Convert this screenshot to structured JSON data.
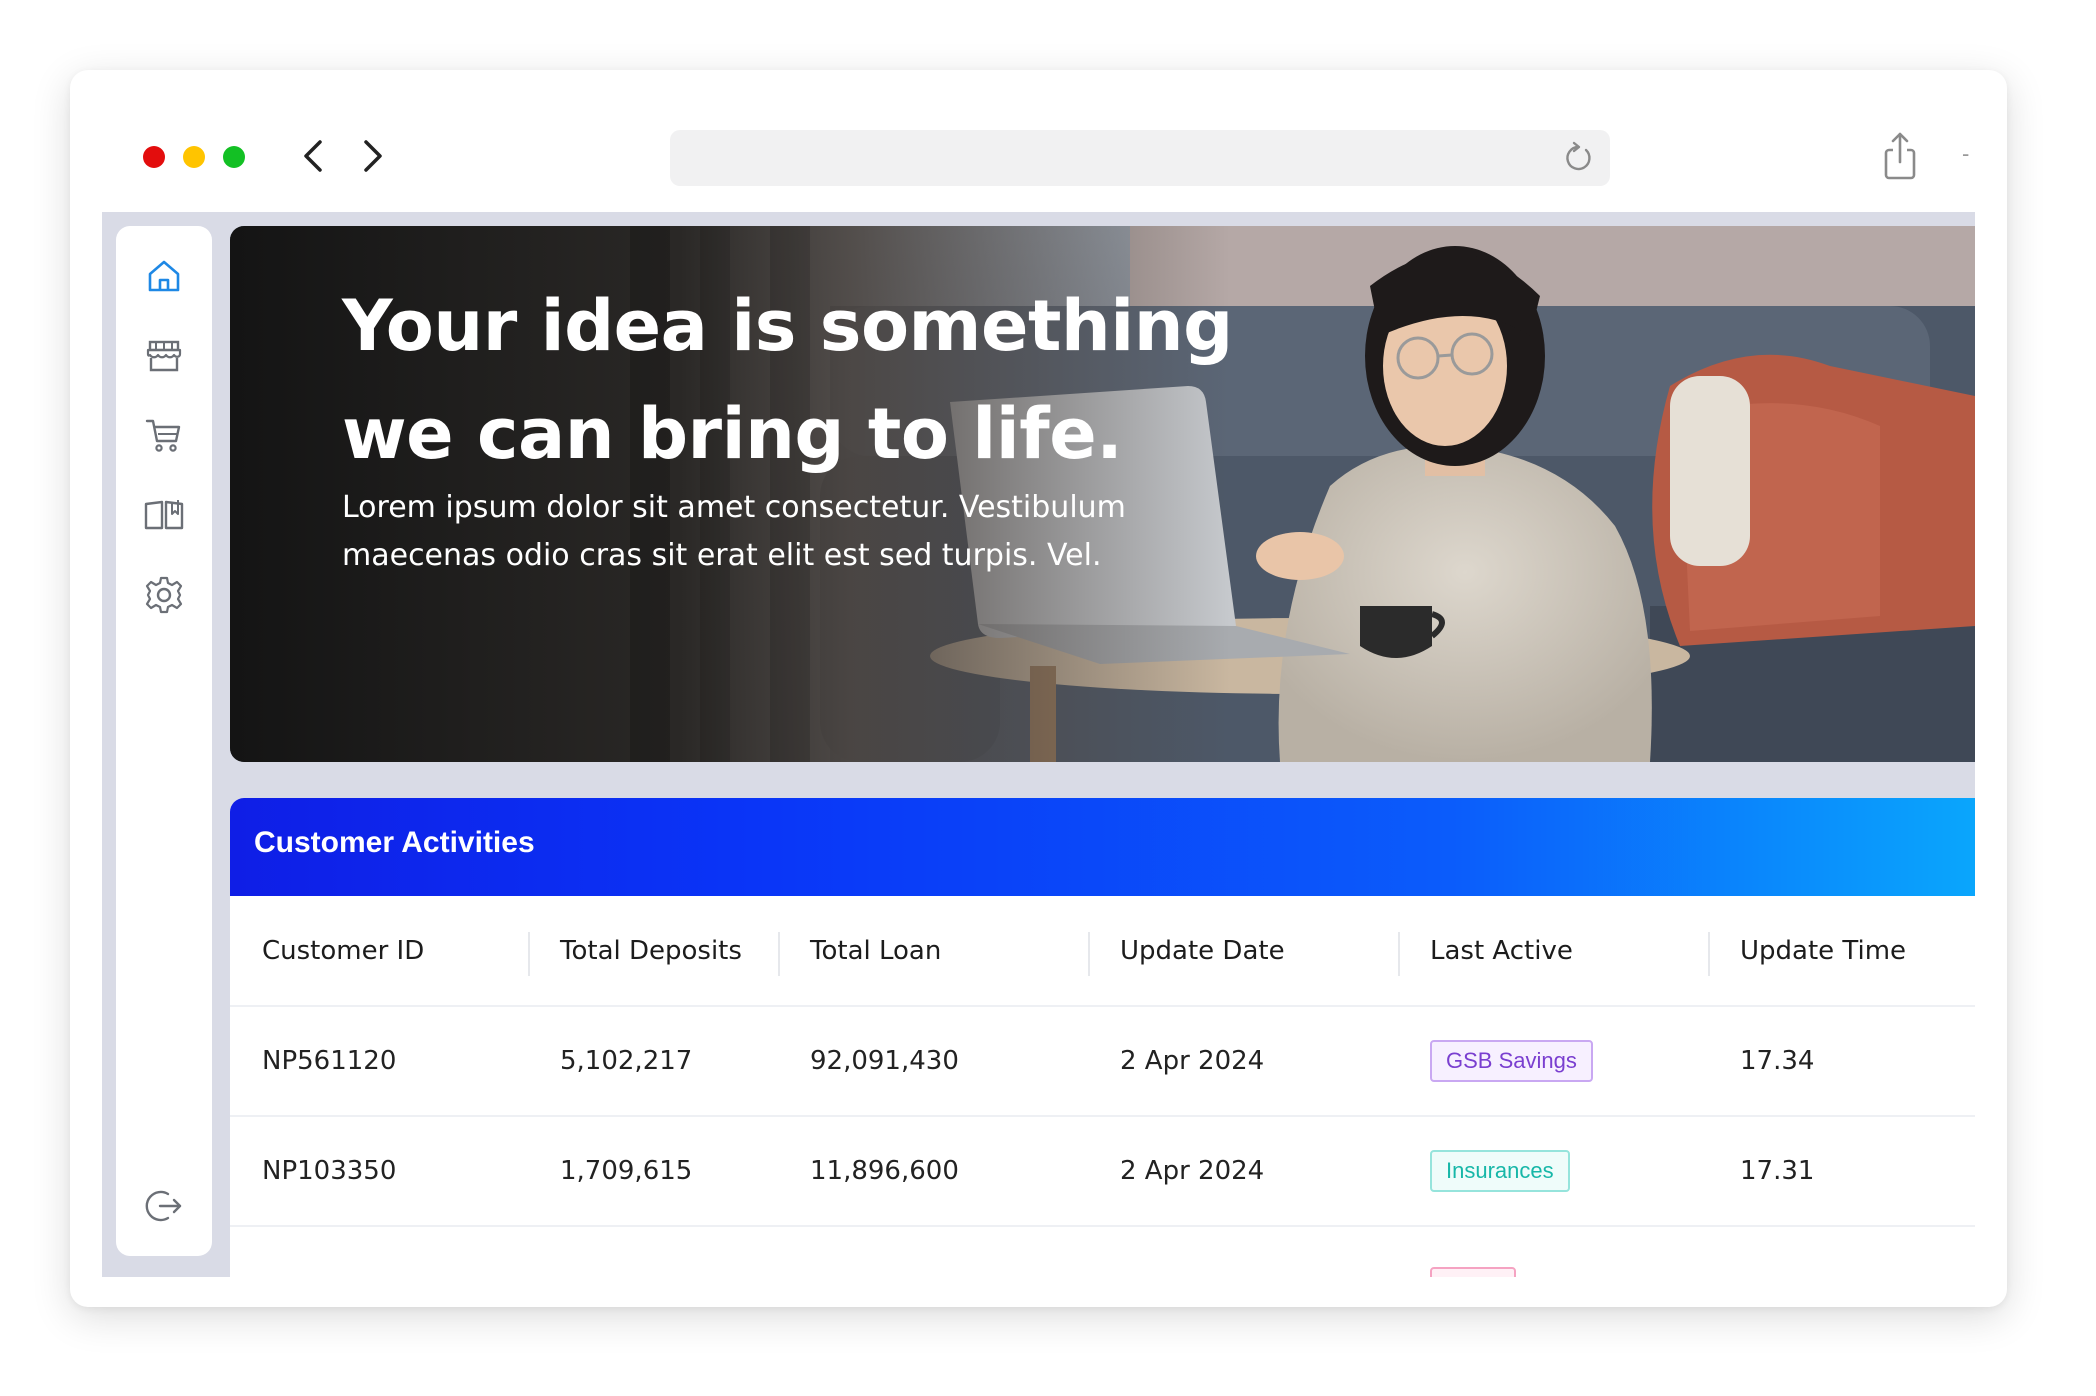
{
  "browser": {
    "url": ""
  },
  "hero": {
    "title_line1": "Your idea is something",
    "title_line2": "we can bring to life.",
    "subtitle_line1": "Lorem ipsum dolor sit amet consectetur. Vestibulum",
    "subtitle_line2": "maecenas odio cras sit erat elit est sed turpis. Vel."
  },
  "sidebar": {
    "items": [
      {
        "icon": "home-icon",
        "active": true
      },
      {
        "icon": "store-icon",
        "active": false
      },
      {
        "icon": "cart-icon",
        "active": false
      },
      {
        "icon": "book-icon",
        "active": false
      },
      {
        "icon": "gear-icon",
        "active": false
      }
    ],
    "logout_icon": "logout-icon"
  },
  "activities": {
    "title": "Customer Activities",
    "columns": [
      "Customer ID",
      "Total Deposits",
      "Total Loan",
      "Update Date",
      "Last Active",
      "Update Time"
    ],
    "rows": [
      {
        "id": "NP561120",
        "deposits": "5,102,217",
        "loan": "92,091,430",
        "date": "2 Apr 2024",
        "last_active": "GSB Savings",
        "badge_style": "purple",
        "time": "17.34"
      },
      {
        "id": "NP103350",
        "deposits": "1,709,615",
        "loan": "11,896,600",
        "date": "2 Apr 2024",
        "last_active": "Insurances",
        "badge_style": "teal",
        "time": "17.31"
      },
      {
        "id": "",
        "deposits": "",
        "loan": "",
        "date": "",
        "last_active": "",
        "badge_style": "pink",
        "time": ""
      }
    ]
  },
  "colors": {
    "accent": "#0a35f7",
    "sidebar_active": "#1e88e5",
    "traffic_red": "#e30d0d",
    "traffic_yellow": "#ffc400",
    "traffic_green": "#13c024"
  }
}
